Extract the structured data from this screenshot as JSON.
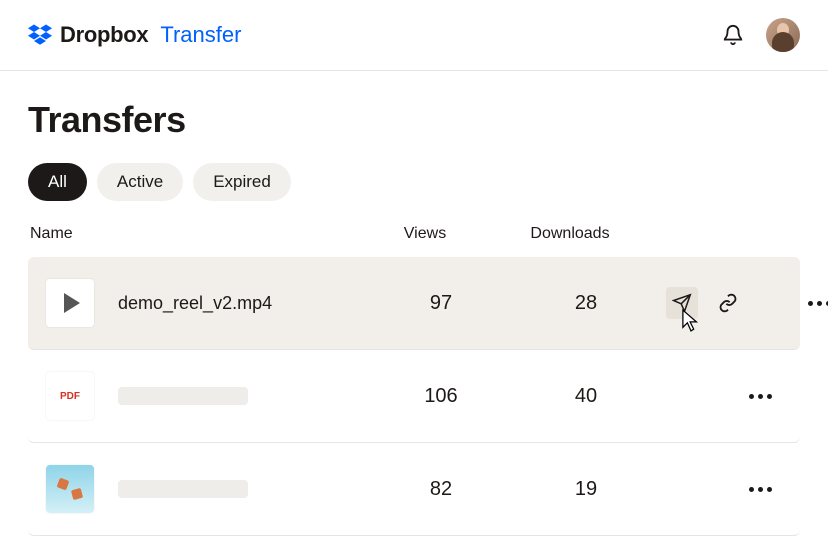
{
  "header": {
    "brand_main": "Dropbox",
    "brand_sub": "Transfer"
  },
  "page": {
    "title": "Transfers"
  },
  "filters": [
    {
      "label": "All",
      "active": true
    },
    {
      "label": "Active",
      "active": false
    },
    {
      "label": "Expired",
      "active": false
    }
  ],
  "columns": {
    "name": "Name",
    "views": "Views",
    "downloads": "Downloads"
  },
  "rows": [
    {
      "name": "demo_reel_v2.mp4",
      "thumb": "video",
      "views": "97",
      "downloads": "28",
      "hovered": true,
      "placeholder": false
    },
    {
      "name": "",
      "thumb": "pdf",
      "views": "106",
      "downloads": "40",
      "hovered": false,
      "placeholder": true,
      "pdf_label": "PDF"
    },
    {
      "name": "",
      "thumb": "img",
      "views": "82",
      "downloads": "19",
      "hovered": false,
      "placeholder": true
    }
  ]
}
